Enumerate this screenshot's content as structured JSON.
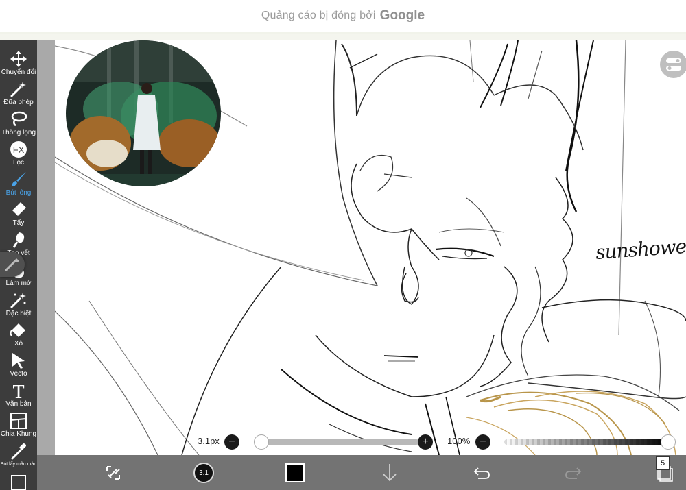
{
  "ad_banner": {
    "text": "Quảng cáo bị đóng bởi",
    "brand": "Google"
  },
  "toolbar": {
    "tools": [
      {
        "id": "transform",
        "label": "Chuyển đổi",
        "icon": "move-arrows-icon",
        "active": false
      },
      {
        "id": "magic-wand",
        "label": "Đũa phép",
        "icon": "magic-wand-icon",
        "active": false
      },
      {
        "id": "lasso",
        "label": "Thòng lọng",
        "icon": "lasso-icon",
        "active": false
      },
      {
        "id": "filter",
        "label": "Lọc",
        "icon": "fx-icon",
        "active": false
      },
      {
        "id": "brush",
        "label": "Bút lông",
        "icon": "brush-icon",
        "active": true
      },
      {
        "id": "eraser",
        "label": "Tẩy",
        "icon": "eraser-icon",
        "active": false
      },
      {
        "id": "smudge",
        "label": "Tạo vết",
        "icon": "smudge-icon",
        "active": false
      },
      {
        "id": "blur",
        "label": "Làm mờ",
        "icon": "droplet-icon",
        "active": false
      },
      {
        "id": "special",
        "label": "Đặc biệt",
        "icon": "sparkle-wand-icon",
        "active": false
      },
      {
        "id": "fill",
        "label": "Xô",
        "icon": "bucket-icon",
        "active": false
      },
      {
        "id": "vector",
        "label": "Vecto",
        "icon": "cursor-arrow-icon",
        "active": false
      },
      {
        "id": "text",
        "label": "Văn bản",
        "icon": "text-t-icon",
        "active": false
      },
      {
        "id": "frame",
        "label": "Chia Khung",
        "icon": "frame-divide-icon",
        "active": false
      },
      {
        "id": "eyedropper",
        "label": "Bút lấy mẫu màu",
        "icon": "eyedropper-icon",
        "active": false
      }
    ],
    "accent_color": "#4aa3e8"
  },
  "canvas": {
    "signature": "sunshower"
  },
  "sliders": {
    "brush_size_label": "3.1px",
    "brush_size_value": 3.1,
    "opacity_label": "100%",
    "opacity_value": 100,
    "minus_symbol": "−",
    "plus_symbol": "+"
  },
  "bottom_bar": {
    "brush_size_badge": "3.1",
    "current_color": "#000000",
    "layer_count": "5",
    "icons": [
      "selection-transform-icon",
      "brush-preview",
      "color-swatch",
      "download-arrow-icon",
      "undo-icon",
      "redo-icon",
      "layers-icon"
    ]
  }
}
